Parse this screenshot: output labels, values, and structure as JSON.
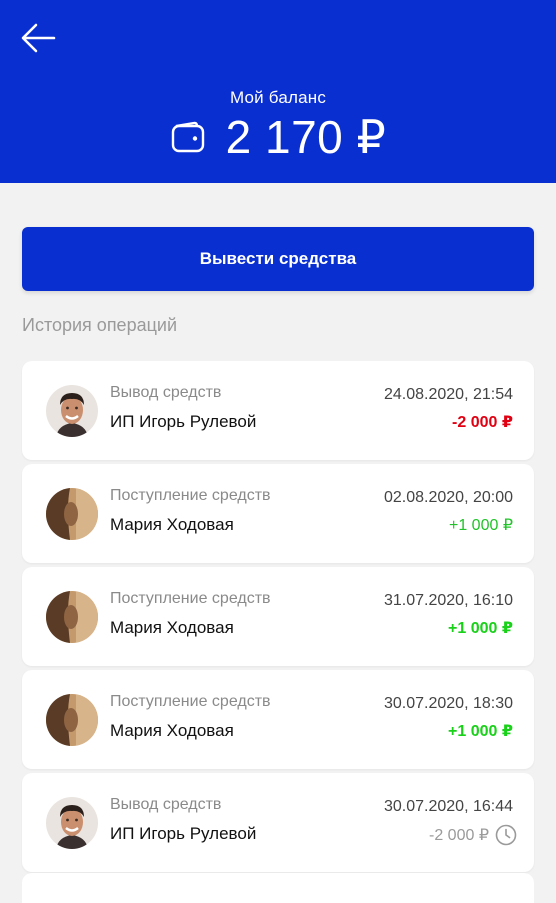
{
  "header": {
    "balance_label": "Мой баланс",
    "balance_amount": "2 170 ₽"
  },
  "withdraw_button": "Вывести средства",
  "history_title": "История операций",
  "colors": {
    "brand": "#0a2fd0",
    "negative": "#e00012",
    "positive": "#19d119",
    "pending": "#9a9a9a"
  },
  "operations": [
    {
      "type": "Вывод средств",
      "name": "ИП Игорь Рулевой",
      "date": "24.08.2020, 21:54",
      "amount": "-2 000 ₽",
      "status": "debit",
      "avatar": "man-portrait"
    },
    {
      "type": "Поступление средств",
      "name": "Мария Ходовая",
      "date": "02.08.2020, 20:00",
      "amount": "+1 000 ₽",
      "status": "credit-light",
      "avatar": "woman-portrait"
    },
    {
      "type": "Поступление средств",
      "name": "Мария Ходовая",
      "date": "31.07.2020, 16:10",
      "amount": "+1 000 ₽",
      "status": "credit",
      "avatar": "woman-portrait"
    },
    {
      "type": "Поступление средств",
      "name": "Мария Ходовая",
      "date": "30.07.2020, 18:30",
      "amount": "+1 000 ₽",
      "status": "credit",
      "avatar": "woman-portrait"
    },
    {
      "type": "Вывод средств",
      "name": "ИП Игорь Рулевой",
      "date": "30.07.2020, 16:44",
      "amount": "-2 000 ₽",
      "status": "pending",
      "avatar": "man-portrait",
      "icon": "clock-icon"
    }
  ]
}
